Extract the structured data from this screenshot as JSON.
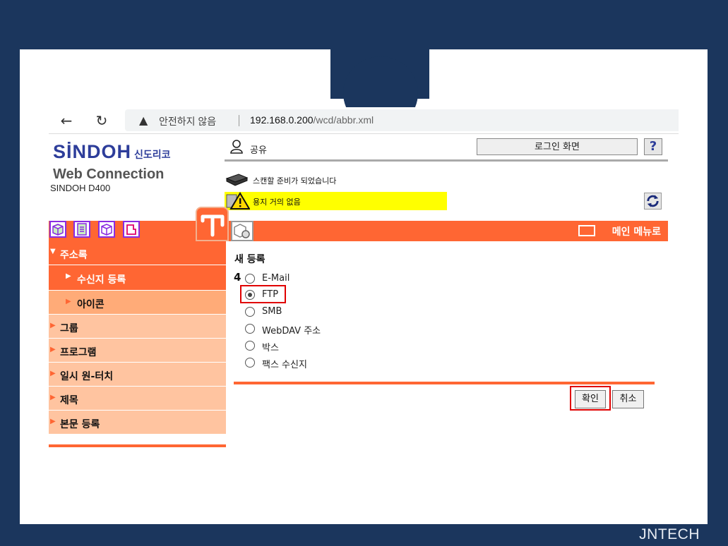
{
  "browser": {
    "back_icon": "arrow-left-icon",
    "reload_icon": "reload-icon",
    "security_warning": "안전하지 않음",
    "url_host": "192.168.0.200",
    "url_path": "/wcd/abbr.xml"
  },
  "header": {
    "logo_main": "SİNDOH",
    "logo_sub": "신도리코",
    "product": "Web Connection",
    "model": "SINDOH D400",
    "user_label": "공유",
    "login_button": "로그인 화면",
    "help_button": "?",
    "status_ready": "스캔할 준비가 되었습니다",
    "status_alert": "용지 거의 없음"
  },
  "tabbar": {
    "main_menu": "메인 메뉴로"
  },
  "sidebar": {
    "items": [
      {
        "label": "주소록",
        "arrow": "▼"
      },
      {
        "label": "수신지 등록",
        "arrow": "▶"
      },
      {
        "label": "아이콘",
        "arrow": "▶"
      },
      {
        "label": "그룹",
        "arrow": "▶"
      },
      {
        "label": "프로그램",
        "arrow": "▶"
      },
      {
        "label": "일시 원-터치",
        "arrow": "▶"
      },
      {
        "label": "제목",
        "arrow": "▶"
      },
      {
        "label": "본문 등록",
        "arrow": "▶"
      }
    ]
  },
  "form": {
    "title": "새 등록",
    "step": "4",
    "options": [
      {
        "label": "E-Mail",
        "checked": false
      },
      {
        "label": "FTP",
        "checked": true
      },
      {
        "label": "SMB",
        "checked": false
      },
      {
        "label": "WebDAV 주소",
        "checked": false
      },
      {
        "label": "박스",
        "checked": false
      },
      {
        "label": "팩스 수신지",
        "checked": false
      }
    ],
    "ok_button": "확인",
    "cancel_button": "취소"
  },
  "footer": {
    "brand": "JNTECH"
  },
  "colors": {
    "accent": "#ff6633",
    "slide_bg": "#1b365d",
    "highlight": "#e00000",
    "alert_bg": "#ffff00"
  }
}
